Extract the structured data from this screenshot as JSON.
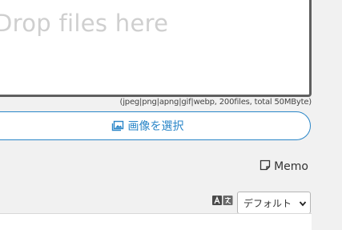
{
  "dropzone": {
    "placeholder": "Drop files here"
  },
  "limits_text": "(jpeg|png|apng|gif|webp, 200files, total 50MByte)",
  "select_button": {
    "label": "画像を選択",
    "icon": "image-icon"
  },
  "memo": {
    "label": "Memo",
    "icon": "memo-icon"
  },
  "language": {
    "icon": "translate-icon",
    "selected": "デフォルト"
  },
  "colors": {
    "accent": "#2a86c8",
    "dropzone_border": "#5f5f5f",
    "background": "#f1f1f1"
  }
}
